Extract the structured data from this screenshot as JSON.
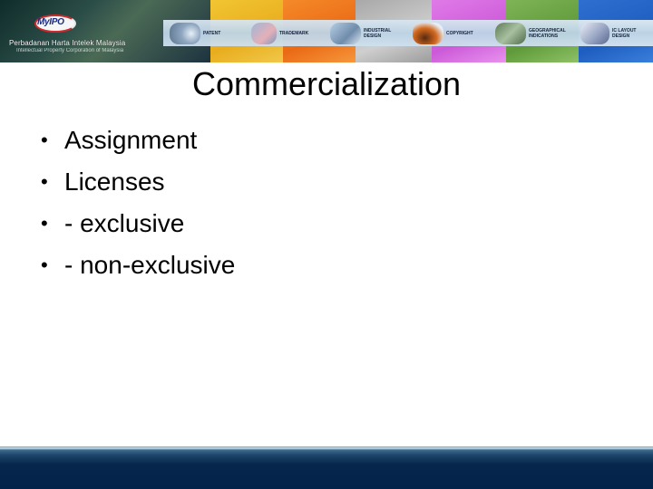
{
  "banner": {
    "logo": "MyIPO",
    "org_name": "Perbadanan Harta Intelek Malaysia",
    "org_subtitle": "Intellectual Property Corporation of Malaysia",
    "categories": [
      {
        "label": "PATENT",
        "color": "#7a8fa8"
      },
      {
        "label": "TRADEMARK",
        "color": "#8aa5c8"
      },
      {
        "label": "INDUSTRIAL\nDESIGN",
        "color": "#7f9ab8"
      },
      {
        "label": "COPYRIGHT",
        "color": "#c0602a"
      },
      {
        "label": "GEOGRAPHICAL\nINDICATIONS",
        "color": "#6c8a5a"
      },
      {
        "label": "IC LAYOUT\nDESIGN",
        "color": "#8d9bb8"
      }
    ]
  },
  "slide": {
    "title": "Commercialization",
    "bullet_symbol": "•",
    "bullets": [
      "Assignment",
      "Licenses",
      "- exclusive",
      "- non-exclusive"
    ]
  },
  "colors": {
    "footer": "#03234b",
    "text": "#000000"
  }
}
